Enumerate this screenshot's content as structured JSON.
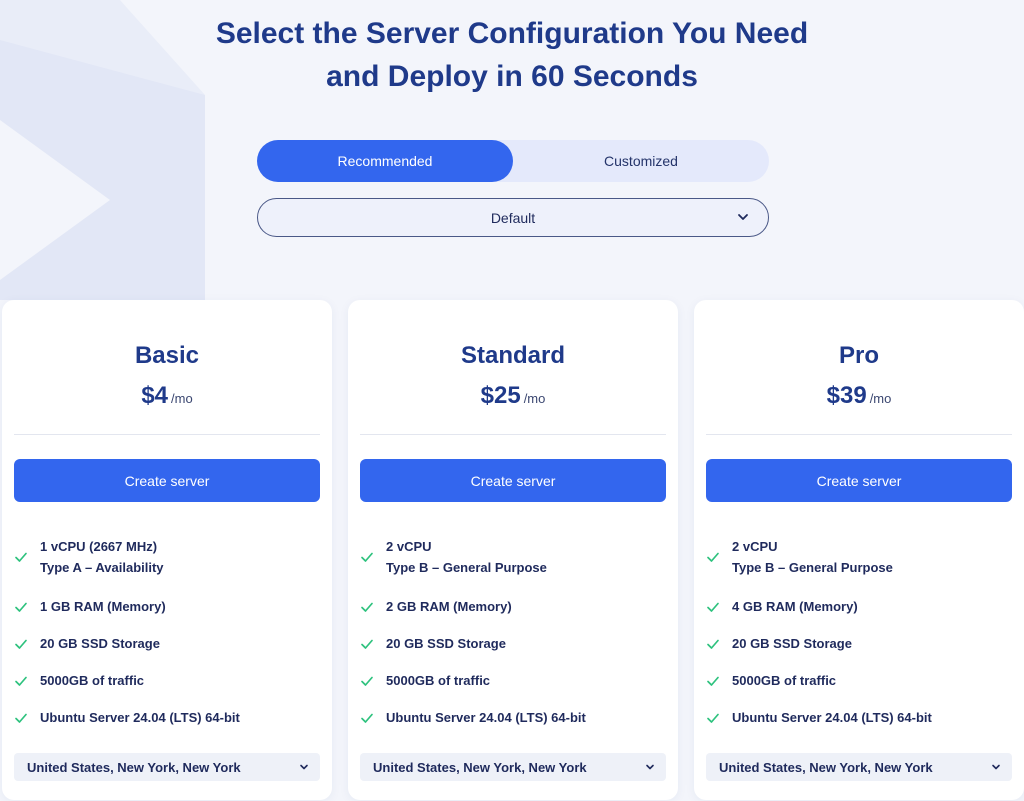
{
  "headline": {
    "line1": "Select the Server Configuration You Need",
    "line2": "and Deploy in 60 Seconds"
  },
  "toggle": {
    "options": [
      {
        "label": "Recommended",
        "active": true
      },
      {
        "label": "Customized",
        "active": false
      }
    ]
  },
  "filter_select": {
    "value": "Default",
    "icon": "chevron-down-icon"
  },
  "colors": {
    "accent": "#3366ee",
    "heading": "#1f3a8a",
    "check": "#2ec27e"
  },
  "plans": [
    {
      "name": "Basic",
      "price": "$4",
      "period": "/mo",
      "button": "Create server",
      "features": [
        [
          "1 vCPU (2667 MHz)",
          "Type A – Availability"
        ],
        [
          "1 GB RAM (Memory)"
        ],
        [
          "20 GB SSD Storage"
        ],
        [
          "5000GB of traffic"
        ],
        [
          "Ubuntu Server 24.04 (LTS) 64-bit"
        ]
      ],
      "location": "United States, New York, New York"
    },
    {
      "name": "Standard",
      "price": "$25",
      "period": "/mo",
      "button": "Create server",
      "features": [
        [
          "2 vCPU",
          "Type B – General Purpose"
        ],
        [
          "2 GB RAM (Memory)"
        ],
        [
          "20 GB SSD Storage"
        ],
        [
          "5000GB of traffic"
        ],
        [
          "Ubuntu Server 24.04 (LTS) 64-bit"
        ]
      ],
      "location": "United States, New York, New York"
    },
    {
      "name": "Pro",
      "price": "$39",
      "period": "/mo",
      "button": "Create server",
      "features": [
        [
          "2 vCPU",
          "Type B – General Purpose"
        ],
        [
          "4 GB RAM (Memory)"
        ],
        [
          "20 GB SSD Storage"
        ],
        [
          "5000GB of traffic"
        ],
        [
          "Ubuntu Server 24.04 (LTS) 64-bit"
        ]
      ],
      "location": "United States, New York, New York"
    }
  ]
}
